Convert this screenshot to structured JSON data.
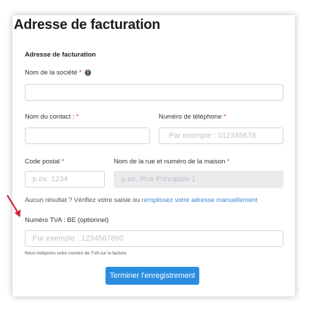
{
  "page_title": "Adresse de facturation",
  "form": {
    "section_title": "Adresse de facturation",
    "company": {
      "label": "Nom de la société",
      "required_mark": "*",
      "info_icon": "i",
      "value": ""
    },
    "contact": {
      "label": "Nom du contact :",
      "required_mark": "*",
      "value": ""
    },
    "phone": {
      "label": "Numéro de téléphone",
      "required_mark": "*",
      "placeholder": "Par exemple : 012345678"
    },
    "postal": {
      "label": "Code postal",
      "required_mark": "*",
      "placeholder": "p.ex. 1234"
    },
    "street": {
      "label": "Nom de la rue et numéro de la maison",
      "required_mark": "*",
      "placeholder": "p.ex. Rue Principale 1"
    },
    "no_result": {
      "text": "Aucun résultat ? Vérifiez votre saisie ou ",
      "link": "remplissez votre adresse manuellement"
    },
    "vat": {
      "label": "Numéro TVA : BE (optionnel)",
      "placeholder": "Par exemple : 1234567890",
      "note": "Nous indiquons votre numéro de TVA sur la facture."
    },
    "submit_label": "Terminer l'enregistrement"
  },
  "colors": {
    "accent": "#2b8de0",
    "required": "#d9373d",
    "link": "#3f86d8",
    "arrow": "#d0243b"
  }
}
